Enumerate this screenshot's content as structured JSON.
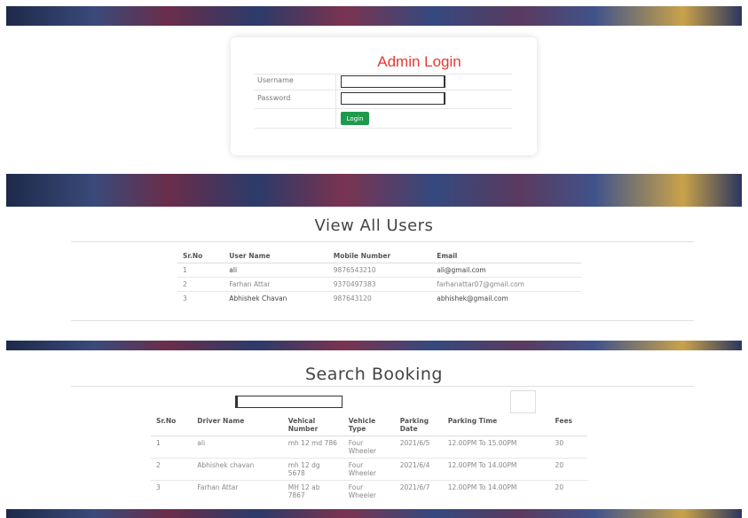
{
  "login": {
    "title": "Admin Login",
    "username_label": "Username",
    "password_label": "Password",
    "button_label": "Login",
    "username_value": "",
    "password_value": ""
  },
  "users": {
    "title": "View All Users",
    "columns": [
      "Sr.No",
      "User Name",
      "Mobile Number",
      "Email"
    ],
    "rows": [
      [
        "1",
        "ali",
        "9876543210",
        "ali@gmail.com"
      ],
      [
        "2",
        "Farhan Attar",
        "9370497383",
        "farhanattar07@gmail.com"
      ],
      [
        "3",
        "Abhishek Chavan",
        "987643120",
        "abhishek@gmail.com"
      ]
    ]
  },
  "bookings": {
    "title": "Search Booking",
    "search_value": "",
    "columns": [
      "Sr.No",
      "Driver Name",
      "Vehical Number",
      "Vehicle Type",
      "Parking Date",
      "Parking Time",
      "Fees"
    ],
    "rows": [
      [
        "1",
        "ali",
        "mh 12 md 786",
        "Four Wheeler",
        "2021/6/5",
        "12.00PM To 15.00PM",
        "30"
      ],
      [
        "2",
        "Abhishek chavan",
        "mh 12 dg 5678",
        "Four Wheeler",
        "2021/6/4",
        "12.00PM To 14.00PM",
        "20"
      ],
      [
        "3",
        "Farhan Attar",
        "MH 12 ab 7867",
        "Four Wheeler",
        "2021/6/7",
        "12.00PM To 14.00PM",
        "20"
      ]
    ]
  }
}
